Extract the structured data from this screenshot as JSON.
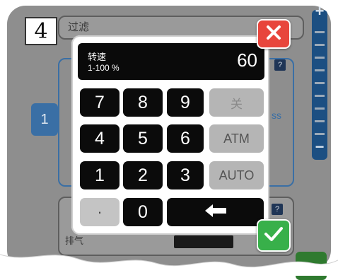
{
  "step": {
    "number": "4"
  },
  "background": {
    "title": "过滤",
    "tab_label": "1",
    "side_text": "ss",
    "bottom_label": "排气",
    "help_symbol": "?"
  },
  "keypad": {
    "display": {
      "label": "转速",
      "range": "1-100 %",
      "value": "60"
    },
    "keys": {
      "k7": "7",
      "k8": "8",
      "k9": "9",
      "off": "关",
      "k4": "4",
      "k5": "5",
      "k6": "6",
      "atm": "ATM",
      "k1": "1",
      "k2": "2",
      "k3": "3",
      "auto": "AUTO",
      "dot": "·",
      "k0": "0",
      "backspace": "⬅"
    },
    "close_icon": "close-icon",
    "confirm_icon": "check-icon"
  },
  "colors": {
    "close_button": "#e8453c",
    "confirm_button": "#38b04a",
    "numeric_key": "#0b0b0b",
    "function_key": "#b5b5b5",
    "accent_blue": "#3a6fa5"
  }
}
